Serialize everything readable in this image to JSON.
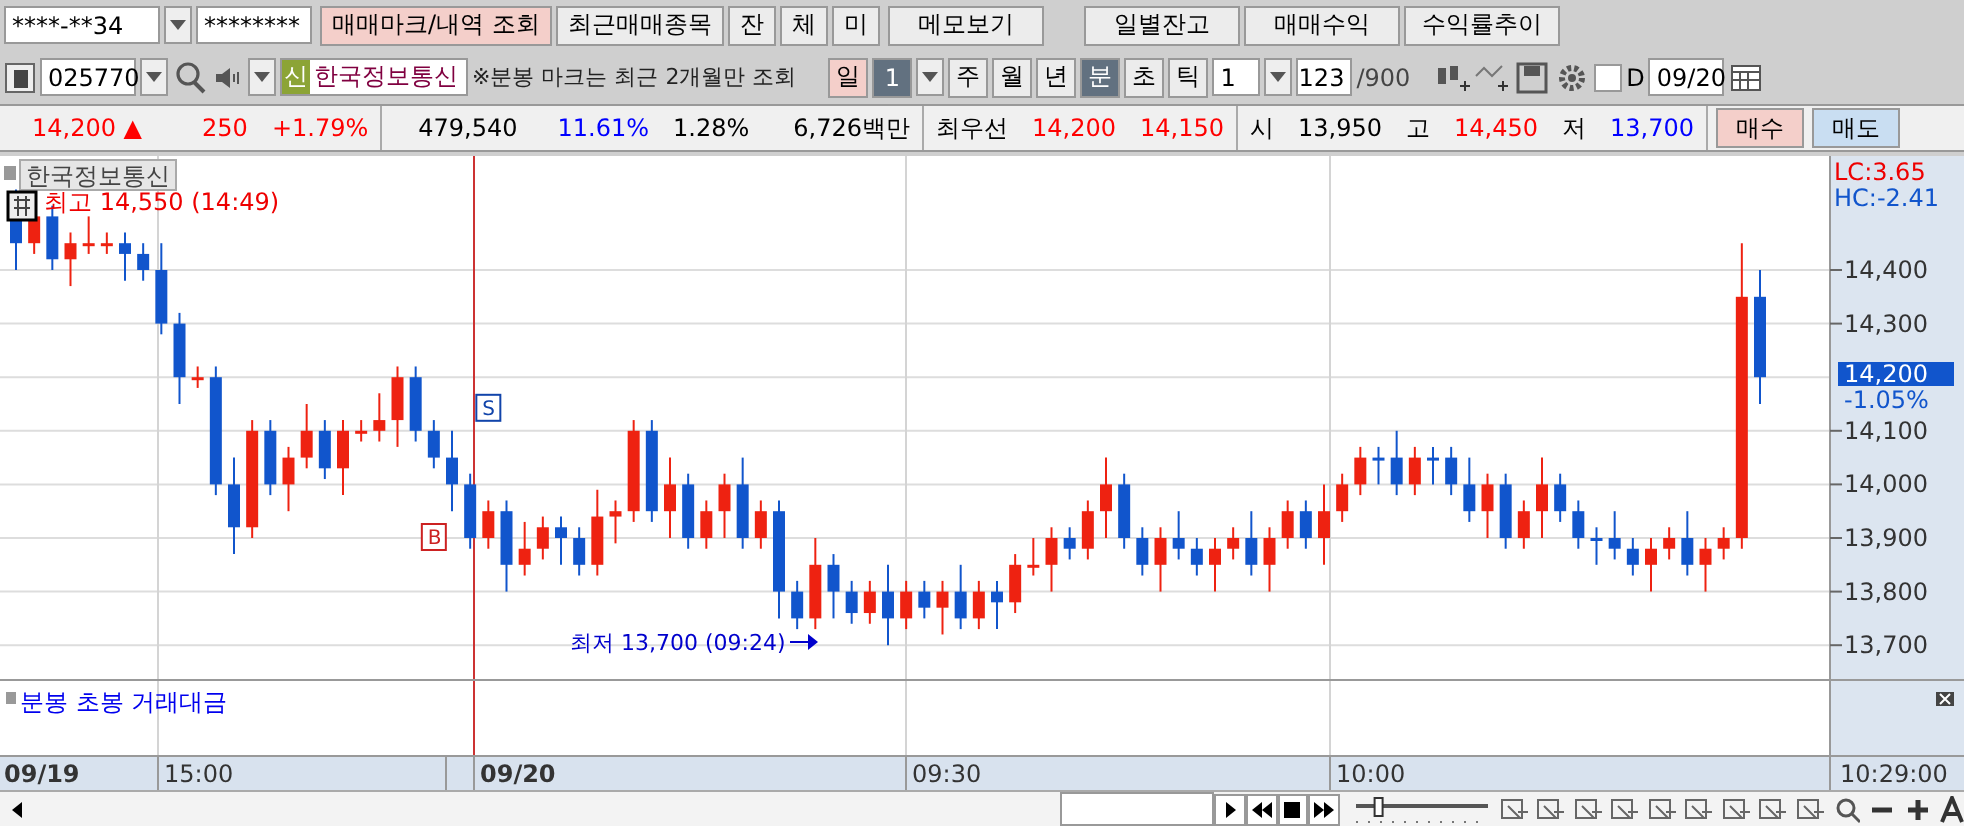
{
  "account": {
    "number": "****-**34",
    "password": "********"
  },
  "top_buttons": [
    {
      "label": "매매마크/내역 조회",
      "selected": true
    },
    {
      "label": "최근매매종목",
      "selected": false
    },
    {
      "label": "잔",
      "selected": false
    },
    {
      "label": "체",
      "selected": false
    },
    {
      "label": "미",
      "selected": false
    },
    {
      "label": "메모보기",
      "selected": false
    }
  ],
  "right_buttons": [
    "일별잔고",
    "매매수익",
    "수익률추이"
  ],
  "stock": {
    "code": "025770",
    "credit_badge": "신",
    "name": "한국정보통신",
    "note": "※분봉 마크는 최근 2개월만 조회"
  },
  "day_button": {
    "label": "일",
    "on": true
  },
  "day_count": "1",
  "periods": [
    {
      "label": "주",
      "selected": false
    },
    {
      "label": "월",
      "selected": false
    },
    {
      "label": "년",
      "selected": false
    },
    {
      "label": "분",
      "selected": true
    },
    {
      "label": "초",
      "selected": false
    },
    {
      "label": "틱",
      "selected": false
    }
  ],
  "interval": "1",
  "count": "123",
  "max_count": "/900",
  "d_checkbox": {
    "label": "D",
    "checked": false
  },
  "date": "09/20",
  "quote": [
    {
      "text": "14,200 ▲",
      "color": "#ff0000"
    },
    {
      "text": "250",
      "color": "#ff0000"
    },
    {
      "text": "+1.79%",
      "color": "#ff0000"
    },
    {
      "text": "479,540",
      "color": "#000000"
    },
    {
      "text": "11.61%",
      "color": "#0000ff"
    },
    {
      "text": "1.28%",
      "color": "#000000"
    },
    {
      "text": "6,726백만",
      "color": "#000000"
    },
    {
      "text": "최우선",
      "color": "#000000"
    },
    {
      "text": "14,200",
      "color": "#ff0000"
    },
    {
      "text": "14,150",
      "color": "#ff0000"
    },
    {
      "text": "시",
      "color": "#000000"
    },
    {
      "text": "13,950",
      "color": "#000000"
    },
    {
      "text": "고",
      "color": "#000000"
    },
    {
      "text": "14,450",
      "color": "#ff0000"
    },
    {
      "text": "저",
      "color": "#000000"
    },
    {
      "text": "13,700",
      "color": "#0000ff"
    }
  ],
  "trade_buttons": [
    {
      "label": "매수",
      "kind": "buy"
    },
    {
      "label": "매도",
      "kind": "sell"
    }
  ],
  "chart": {
    "title": "한국정보통신",
    "high_note": "최고 14,550 (14:49)",
    "low_note": "최저 13,700 (09:24)",
    "buy_mark": "B",
    "sell_mark": "S",
    "lc": "LC:3.65",
    "hc": "HC:-2.41",
    "yticks": [
      "14,400",
      "14,300",
      "14,100",
      "14,000",
      "13,900",
      "13,800",
      "13,700"
    ],
    "current_price": "14,200",
    "current_change": "-1.05%"
  },
  "speed_slider": {
    "level": 0.15
  },
  "indicator_panel": {
    "label": "분봉 초봉 거래대금"
  },
  "time_axis": [
    {
      "label": "09/19",
      "kind": "date"
    },
    {
      "label": "15:00",
      "kind": "time"
    },
    {
      "label": "09/20",
      "kind": "date"
    },
    {
      "label": "09:30",
      "kind": "time"
    },
    {
      "label": "10:00",
      "kind": "time"
    },
    {
      "label": "10:29:00",
      "kind": "end"
    }
  ]
}
